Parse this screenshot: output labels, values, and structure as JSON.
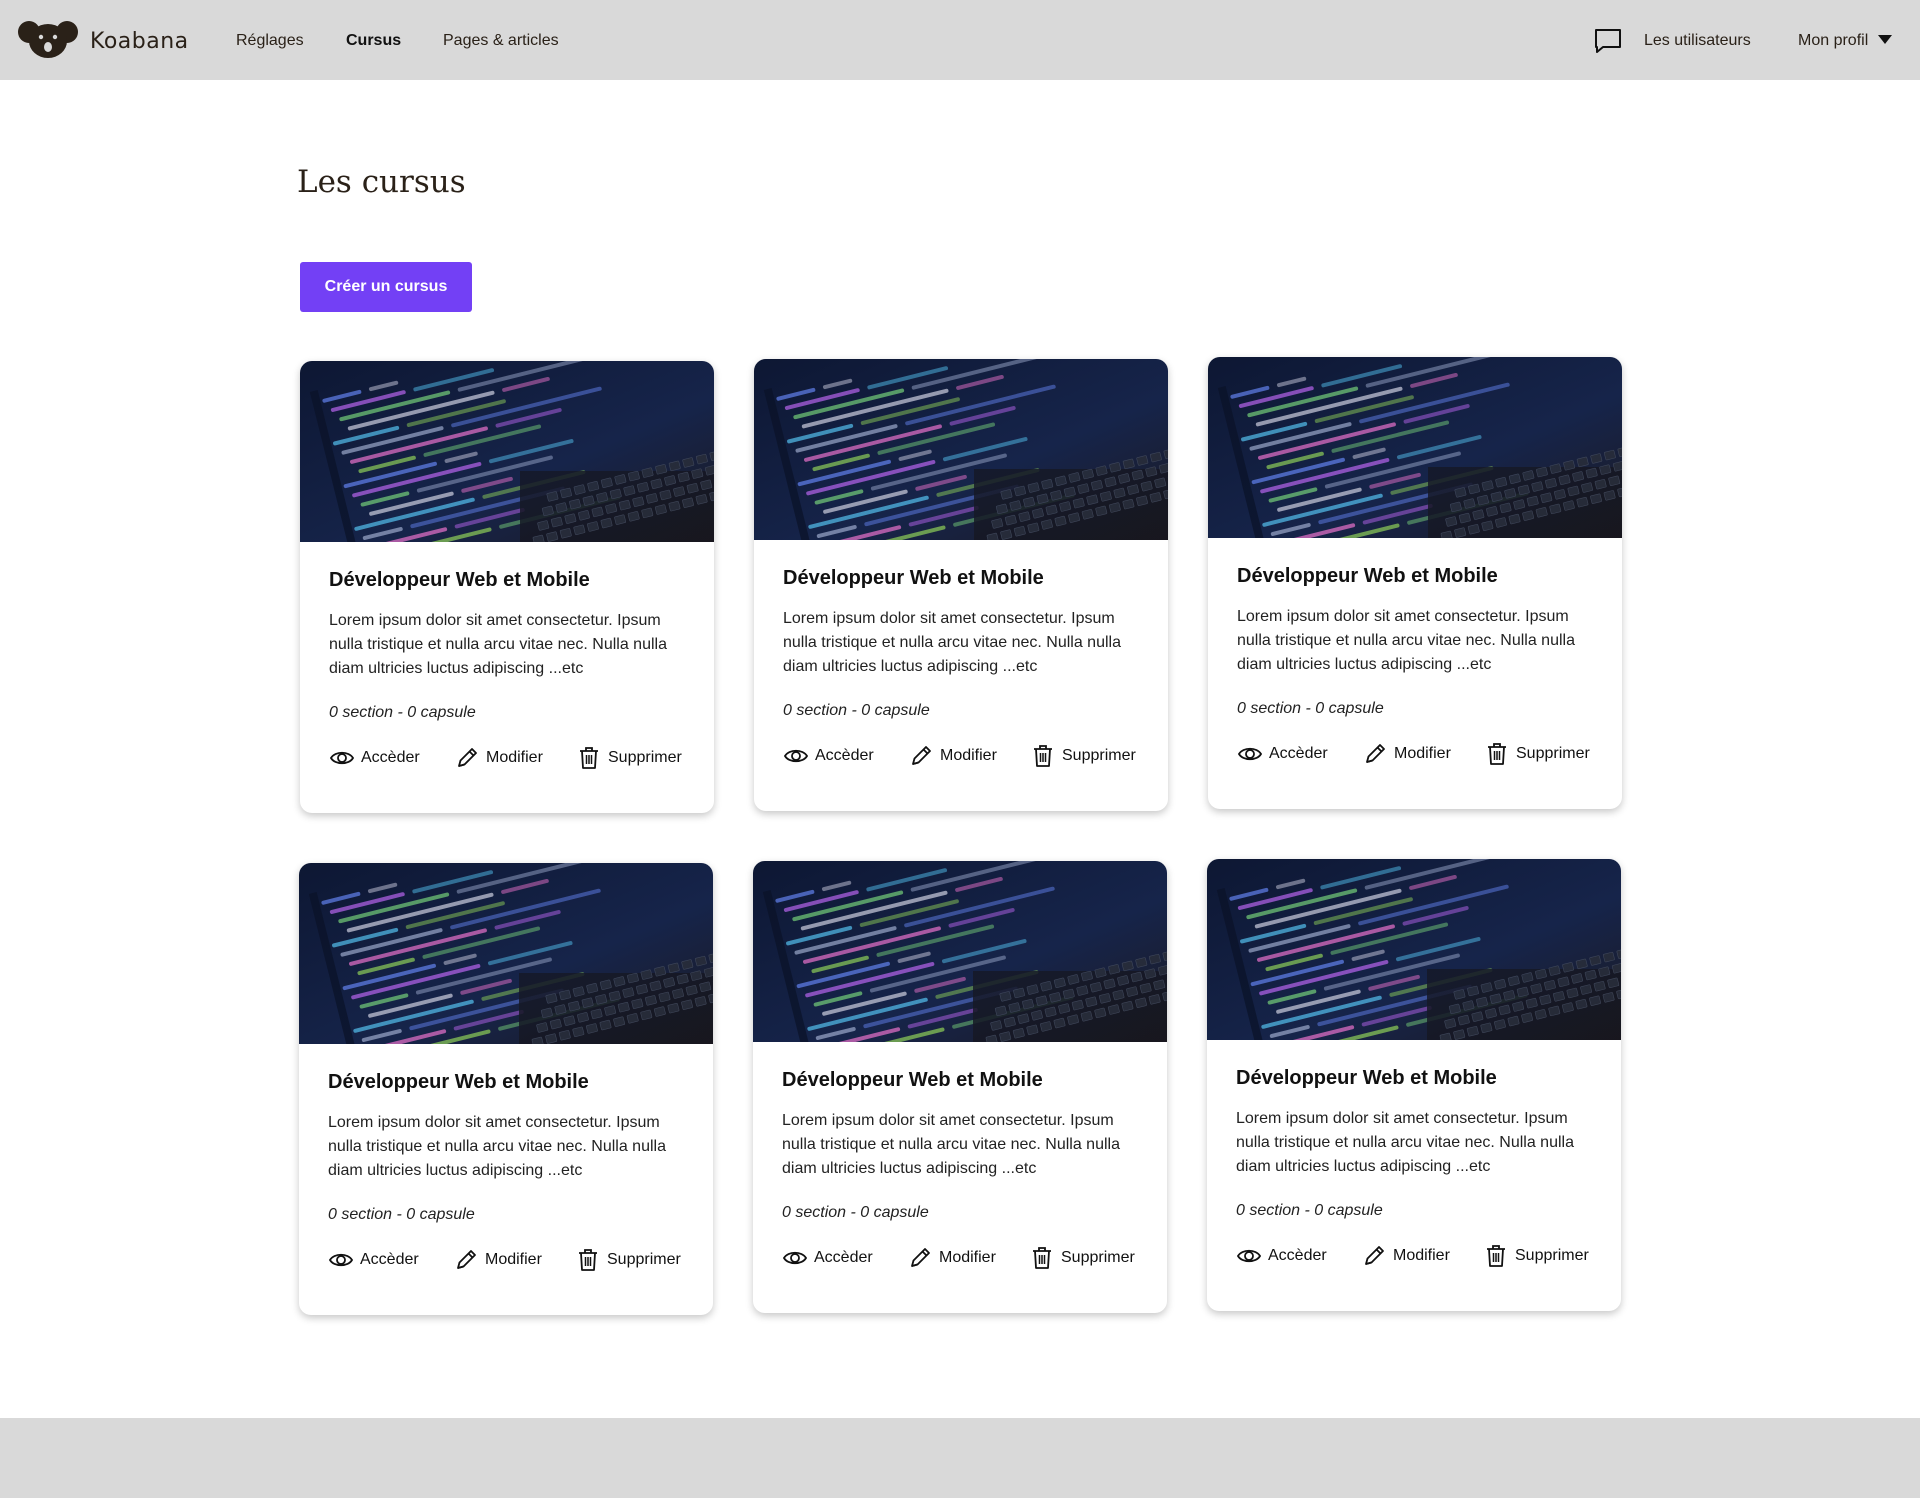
{
  "header": {
    "brand": "Koabana",
    "nav": [
      "Réglages",
      "Cursus",
      "Pages & articles"
    ],
    "users_label": "Les utilisateurs",
    "profile_label": "Mon profil"
  },
  "page": {
    "title": "Les cursus",
    "create_button": "Créer un cursus"
  },
  "courses": [
    {
      "title": "Développeur Web et Mobile",
      "description": "Lorem ipsum dolor sit amet consectetur. Ipsum nulla tristique et nulla arcu vitae nec. Nulla nulla diam ultricies luctus adipiscing ...etc",
      "meta": "0 section - 0 capsule",
      "view_label": "Accèder",
      "edit_label": "Modifier",
      "delete_label": "Supprimer"
    },
    {
      "title": "Développeur Web et Mobile",
      "description": "Lorem ipsum dolor sit amet consectetur. Ipsum nulla tristique et nulla arcu vitae nec. Nulla nulla diam ultricies luctus adipiscing ...etc",
      "meta": "0 section - 0 capsule",
      "view_label": "Accèder",
      "edit_label": "Modifier",
      "delete_label": "Supprimer"
    },
    {
      "title": "Développeur Web et Mobile",
      "description": "Lorem ipsum dolor sit amet consectetur. Ipsum nulla tristique et nulla arcu vitae nec. Nulla nulla diam ultricies luctus adipiscing ...etc",
      "meta": "0 section - 0 capsule",
      "view_label": "Accèder",
      "edit_label": "Modifier",
      "delete_label": "Supprimer"
    },
    {
      "title": "Développeur Web et Mobile",
      "description": "Lorem ipsum dolor sit amet consectetur. Ipsum nulla tristique et nulla arcu vitae nec. Nulla nulla diam ultricies luctus adipiscing ...etc",
      "meta": "0 section - 0 capsule",
      "view_label": "Accèder",
      "edit_label": "Modifier",
      "delete_label": "Supprimer"
    },
    {
      "title": "Développeur Web et Mobile",
      "description": "Lorem ipsum dolor sit amet consectetur. Ipsum nulla tristique et nulla arcu vitae nec. Nulla nulla diam ultricies luctus adipiscing ...etc",
      "meta": "0 section - 0 capsule",
      "view_label": "Accèder",
      "edit_label": "Modifier",
      "delete_label": "Supprimer"
    },
    {
      "title": "Développeur Web et Mobile",
      "description": "Lorem ipsum dolor sit amet consectetur. Ipsum nulla tristique et nulla arcu vitae nec. Nulla nulla diam ultricies luctus adipiscing ...etc",
      "meta": "0 section - 0 capsule",
      "view_label": "Accèder",
      "edit_label": "Modifier",
      "delete_label": "Supprimer"
    }
  ],
  "colors": {
    "header_bg": "#d9d9d9",
    "accent": "#7340f5",
    "brand_text": "#2a2118"
  }
}
